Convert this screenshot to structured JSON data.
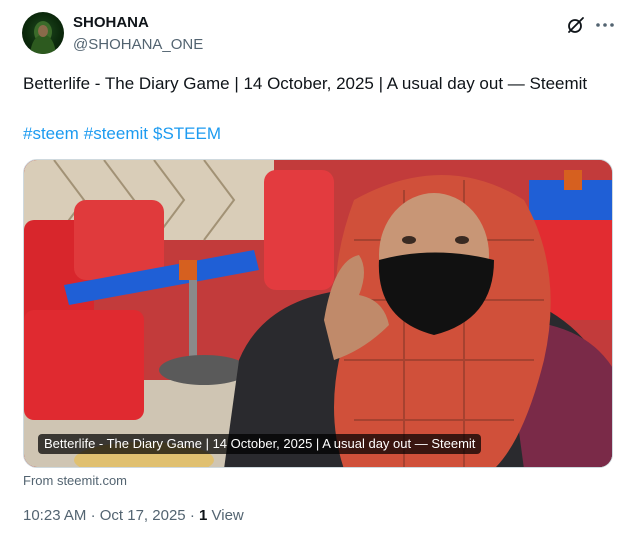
{
  "author": {
    "display_name": "SHOHANA",
    "handle": "@SHOHANA_ONE"
  },
  "post": {
    "text": "Betterlife - The Diary Game | 14 October, 2025 | A usual day out — Steemit",
    "hashtags": [
      "#steem",
      "#steemit",
      "$STEEM"
    ]
  },
  "media": {
    "caption": "Betterlife - The Diary Game | 14 October, 2025 | A usual day out — Steemit"
  },
  "link": {
    "from": "From steemit.com"
  },
  "meta": {
    "time": "10:23 AM",
    "separator": "·",
    "date": "Oct 17, 2025",
    "views_count": "1",
    "views_label": "View"
  },
  "icons": {
    "grok": "x-slash-icon",
    "more": "more-icon"
  },
  "colors": {
    "link": "#1d9bf0",
    "text": "#0f1419",
    "muted": "#536471"
  }
}
